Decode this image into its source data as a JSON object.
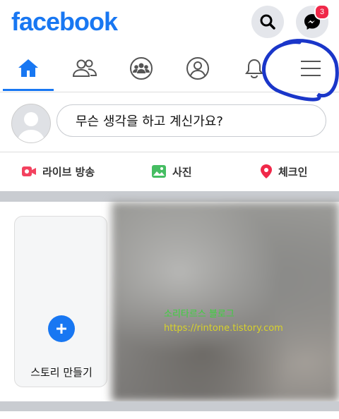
{
  "header": {
    "logo": "facebook",
    "messenger_badge": "3"
  },
  "tabs": [
    {
      "name": "home",
      "active": true
    },
    {
      "name": "friends",
      "active": false
    },
    {
      "name": "groups",
      "active": false
    },
    {
      "name": "profile",
      "active": false
    },
    {
      "name": "notifications",
      "active": false
    },
    {
      "name": "menu",
      "active": false
    }
  ],
  "composer": {
    "prompt": "무슨 생각을 하고 계신가요?"
  },
  "actions": {
    "live": "라이브 방송",
    "photo": "사진",
    "checkin": "체크인"
  },
  "stories": {
    "create_label": "스토리 만들기"
  },
  "watermark": {
    "line1": "소리타르스 블로그",
    "line2": "https://rintone.tistory.com"
  },
  "colors": {
    "brand": "#1877f2",
    "badge": "#f02849",
    "live": "#f3425f",
    "photo": "#45bd62",
    "checkin": "#f02849"
  }
}
